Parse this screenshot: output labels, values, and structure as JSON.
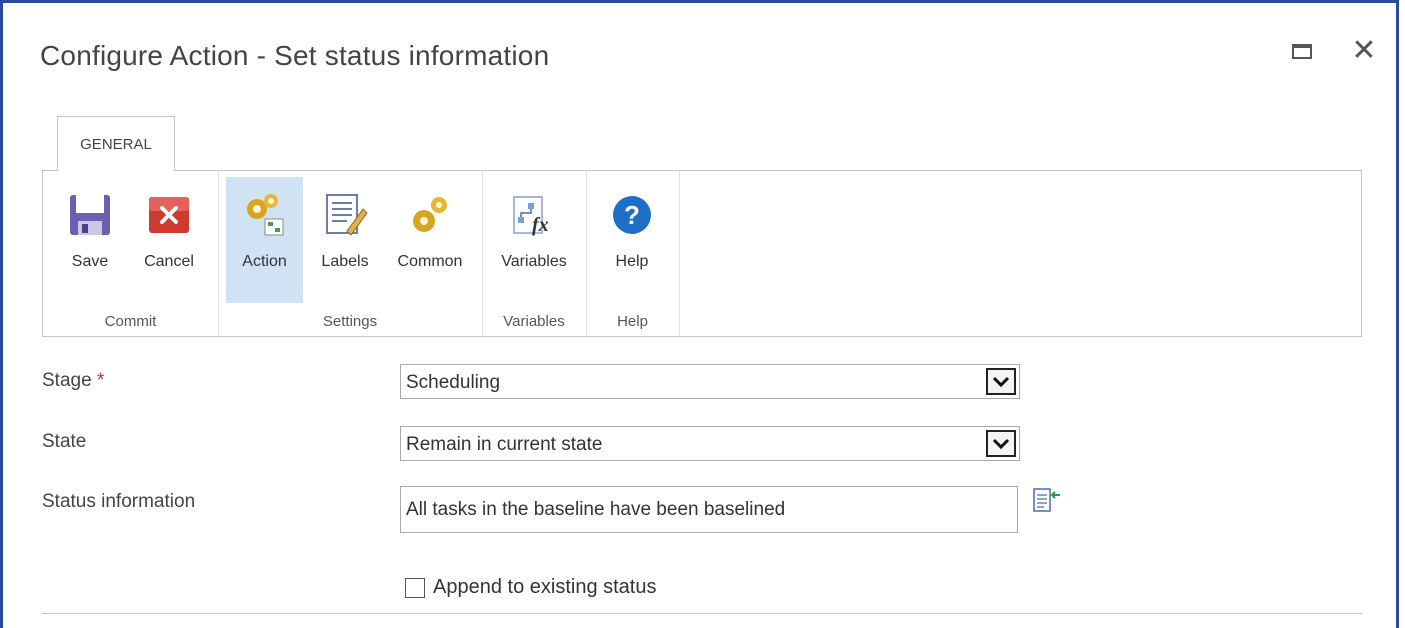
{
  "dialog": {
    "title": "Configure Action - Set status information",
    "maximize_icon": "maximize-icon",
    "close_icon": "close-icon"
  },
  "ribbon": {
    "tab_label": "GENERAL",
    "groups": [
      {
        "label": "Commit",
        "buttons": [
          {
            "label": "Save",
            "icon": "save-icon"
          },
          {
            "label": "Cancel",
            "icon": "cancel-icon"
          }
        ]
      },
      {
        "label": "Settings",
        "buttons": [
          {
            "label": "Action",
            "icon": "action-gears-icon",
            "selected": true
          },
          {
            "label": "Labels",
            "icon": "labels-document-icon"
          },
          {
            "label": "Common",
            "icon": "common-gears-icon"
          }
        ]
      },
      {
        "label": "Variables",
        "buttons": [
          {
            "label": "Variables",
            "icon": "variables-fx-icon"
          }
        ]
      },
      {
        "label": "Help",
        "buttons": [
          {
            "label": "Help",
            "icon": "help-icon"
          }
        ]
      }
    ]
  },
  "form": {
    "stage": {
      "label": "Stage",
      "required_mark": "*",
      "value": "Scheduling"
    },
    "state": {
      "label": "State",
      "value": "Remain in current state"
    },
    "status_information": {
      "label": "Status information",
      "value": "All tasks in the baseline have been baselined"
    },
    "append": {
      "label": "Append to existing status",
      "checked": false
    }
  },
  "colors": {
    "border_accent": "#2a4a9a",
    "selected_bg": "#cfe3f5",
    "required": "#c0392b"
  }
}
